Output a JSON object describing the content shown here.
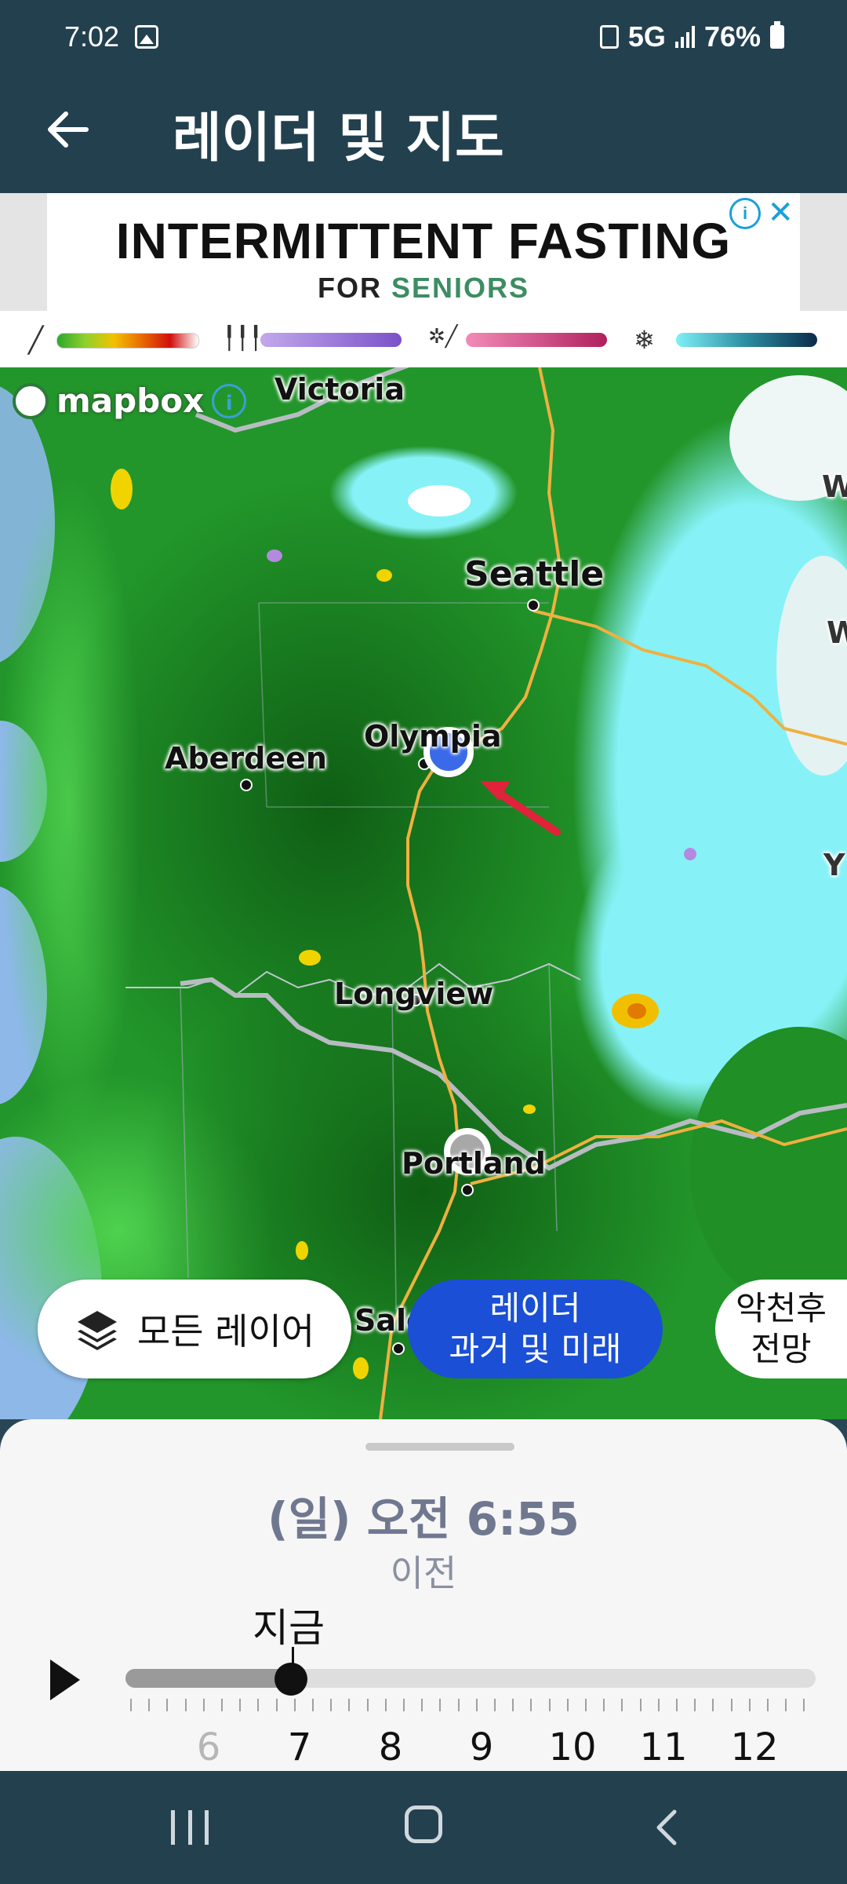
{
  "status_bar": {
    "time": "7:02",
    "network": "5G",
    "battery": "76%"
  },
  "app_bar": {
    "title": "레이더 및 지도"
  },
  "ad": {
    "headline": "INTERMITTENT FASTING",
    "sub_prefix": "FOR ",
    "sub_accent": "SENIORS"
  },
  "legend": [
    {
      "icon": "rain-icon",
      "glyph": "╱",
      "colors": [
        "#2da82d",
        "#f2c200",
        "#d01010",
        "#ffffff"
      ]
    },
    {
      "icon": "ice-icon",
      "glyph": "┃┃┃",
      "colors": [
        "#c2a8ec",
        "#7a52c8"
      ]
    },
    {
      "icon": "mix-icon",
      "glyph": "❄╱",
      "colors": [
        "#f28bb8",
        "#b0205e"
      ]
    },
    {
      "icon": "snow-icon",
      "glyph": "❄",
      "colors": [
        "#7ff0f6",
        "#0c2b4a"
      ]
    }
  ],
  "map": {
    "attribution": "mapbox",
    "cities": [
      {
        "name": "Victoria"
      },
      {
        "name": "Seattle"
      },
      {
        "name": "Olympia"
      },
      {
        "name": "Aberdeen"
      },
      {
        "name": "Longview"
      },
      {
        "name": "Portland"
      },
      {
        "name": "Salem"
      }
    ],
    "edge_labels": [
      "W",
      "W",
      "Y"
    ]
  },
  "buttons": {
    "all_layers": "모든 레이어",
    "radar_line1": "레이더",
    "radar_line2": "과거 및 미래",
    "severe_line1": "악천후",
    "severe_line2": "전망"
  },
  "timeline": {
    "time": "(일) 오전 6:55",
    "period": "이전",
    "now_label": "지금",
    "hours": [
      "6",
      "7",
      "8",
      "9",
      "10",
      "11",
      "12"
    ],
    "progress": 0.24
  },
  "colors": {
    "app_bar": "#23404f",
    "radar_button": "#1a4fd6",
    "ad_accent": "#3c8d62"
  }
}
